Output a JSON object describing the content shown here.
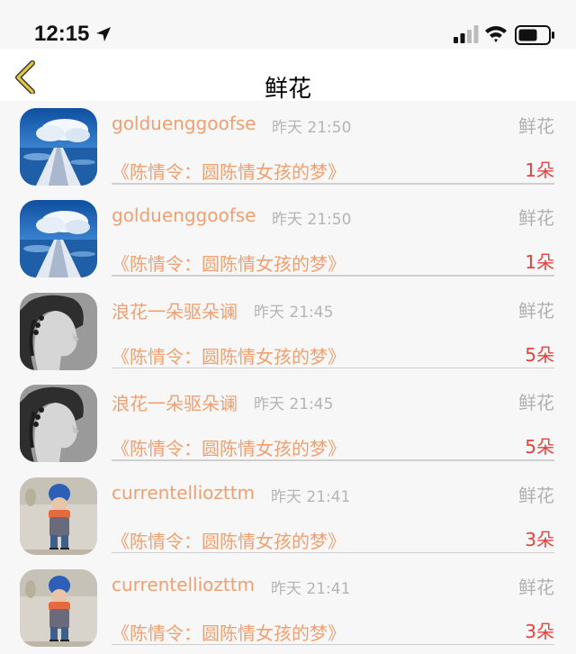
{
  "status_bar": {
    "time": "12:15",
    "icons": [
      "location-arrow-icon",
      "cellular-signal-icon",
      "wifi-icon",
      "battery-icon"
    ]
  },
  "nav": {
    "back_icon": "chevron-left-icon",
    "title": "鲜花"
  },
  "colors": {
    "accent": "#f0a070",
    "count": "#e8403c",
    "muted": "#b0b0b0",
    "back_icon": "#e6c83c"
  },
  "items": [
    {
      "user": "golduenggoofse",
      "time": "昨天 21:50",
      "type": "鲜花",
      "book": "《陈情令：圆陈情女孩的梦》",
      "count": "1朵",
      "avatar": "ocean-pier-avatar"
    },
    {
      "user": "golduenggoofse",
      "time": "昨天 21:50",
      "type": "鲜花",
      "book": "《陈情令：圆陈情女孩的梦》",
      "count": "1朵",
      "avatar": "ocean-pier-avatar"
    },
    {
      "user": "浪花一朵驱朵谰",
      "time": "昨天 21:45",
      "type": "鲜花",
      "book": "《陈情令：圆陈情女孩的梦》",
      "count": "5朵",
      "avatar": "girl-profile-sketch-avatar"
    },
    {
      "user": "浪花一朵驱朵谰",
      "time": "昨天 21:45",
      "type": "鲜花",
      "book": "《陈情令：圆陈情女孩的梦》",
      "count": "5朵",
      "avatar": "girl-profile-sketch-avatar"
    },
    {
      "user": "currentelliozttm",
      "time": "昨天 21:41",
      "type": "鲜花",
      "book": "《陈情令：圆陈情女孩的梦》",
      "count": "3朵",
      "avatar": "toddler-blue-hat-avatar"
    },
    {
      "user": "currentelliozttm",
      "time": "昨天 21:41",
      "type": "鲜花",
      "book": "《陈情令：圆陈情女孩的梦》",
      "count": "3朵",
      "avatar": "toddler-blue-hat-avatar"
    }
  ]
}
